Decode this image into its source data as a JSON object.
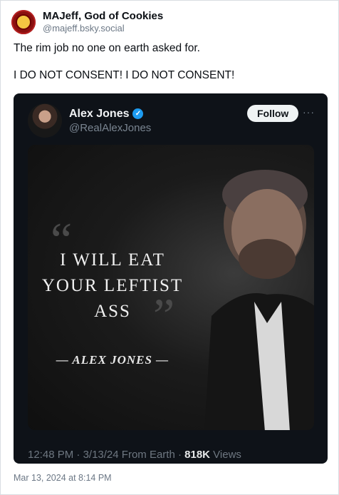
{
  "post": {
    "author": {
      "display_name": "MAJeff, God of Cookies",
      "handle": "@majeff.bsky.social"
    },
    "text_lines": [
      "The rim job no one on earth asked for.",
      "I DO NOT CONSENT! I DO NOT CONSENT!"
    ],
    "timestamp": "Mar 13, 2024 at 8:14 PM"
  },
  "embed": {
    "author_name": "Alex Jones",
    "author_handle": "@RealAlexJones",
    "verified_mark": "✓",
    "follow_label": "Follow",
    "more_label": "···",
    "quote_image": {
      "line1": "I WILL EAT",
      "line2": "YOUR LEFTIST",
      "line3": "ASS",
      "attribution": "— ALEX JONES —"
    },
    "meta": {
      "time": "12:48 PM",
      "sep1": "·",
      "date": "3/13/24",
      "location": "From Earth",
      "sep2": "·",
      "views_count": "818K",
      "views_label": "Views"
    }
  },
  "colors": {
    "embed_bg": "#0e1218",
    "verified": "#1d9bf0",
    "follow_bg": "#eff3f4"
  }
}
